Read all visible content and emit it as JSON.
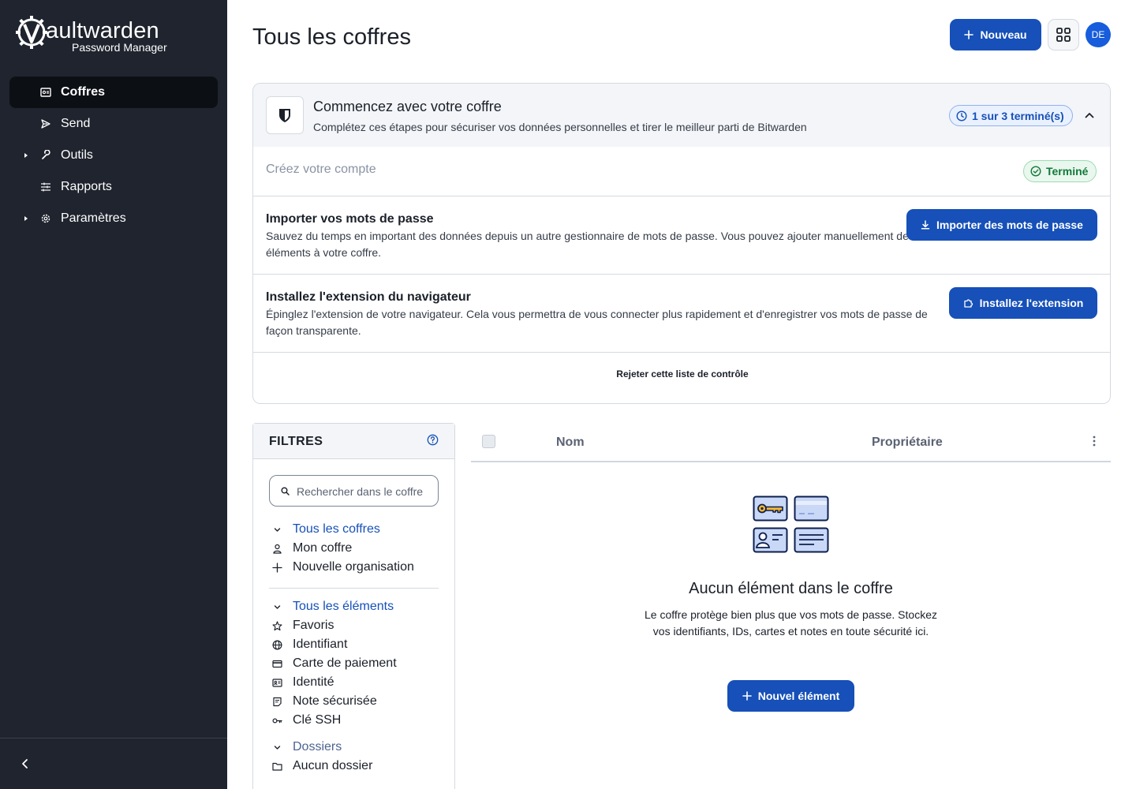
{
  "sidebar": {
    "logo_wordmark": "aultwarden",
    "logo_subtitle": "Password Manager",
    "items": [
      {
        "label": "Coffres",
        "icon": "vault-icon",
        "active": true
      },
      {
        "label": "Send",
        "icon": "send-icon"
      },
      {
        "label": "Outils",
        "icon": "tools-icon",
        "expandable": true
      },
      {
        "label": "Rapports",
        "icon": "reports-icon"
      },
      {
        "label": "Paramètres",
        "icon": "gear-icon",
        "expandable": true
      }
    ]
  },
  "header": {
    "title": "Tous les coffres",
    "new_button": "Nouveau",
    "avatar_initials": "DE"
  },
  "checklist": {
    "title": "Commencez avec votre coffre",
    "subtitle": "Complétez ces étapes pour sécuriser vos données personnelles et tirer le meilleur parti de Bitwarden",
    "progress": "1 sur 3 terminé(s)",
    "steps": [
      {
        "title": "Créez votre compte",
        "status": "Terminé"
      },
      {
        "title": "Importer vos mots de passe",
        "description": "Sauvez du temps en important des données depuis un autre gestionnaire de mots de passe. Vous pouvez ajouter manuellement des éléments à votre coffre.",
        "button": "Importer des mots de passe"
      },
      {
        "title": "Installez l'extension du navigateur",
        "description": "Épinglez l'extension de votre navigateur. Cela vous permettra de vous connecter plus rapidement et d'enregistrer vos mots de passe de façon transparente.",
        "button": "Installez l'extension"
      }
    ],
    "dismiss": "Rejeter cette liste de contrôle"
  },
  "filters": {
    "title": "FILTRES",
    "search_placeholder": "Rechercher dans le coffre",
    "vaults_header": "Tous les coffres",
    "vaults": [
      "Mon coffre",
      "Nouvelle organisation"
    ],
    "types_header": "Tous les éléments",
    "types": [
      "Favoris",
      "Identifiant",
      "Carte de paiement",
      "Identité",
      "Note sécurisée",
      "Clé SSH"
    ],
    "folders_header": "Dossiers",
    "folders": [
      "Aucun dossier"
    ]
  },
  "table": {
    "columns": [
      "Nom",
      "Propriétaire"
    ]
  },
  "empty_state": {
    "title": "Aucun élément dans le coffre",
    "text": "Le coffre protège bien plus que vos mots de passe. Stockez vos identifiants, IDs, cartes et notes en toute sécurité ici.",
    "button": "Nouvel élément"
  },
  "colors": {
    "sidebar_bg": "#1f242e",
    "primary": "#1650b8",
    "avatar": "#175ddc",
    "success": "#127a3a"
  }
}
